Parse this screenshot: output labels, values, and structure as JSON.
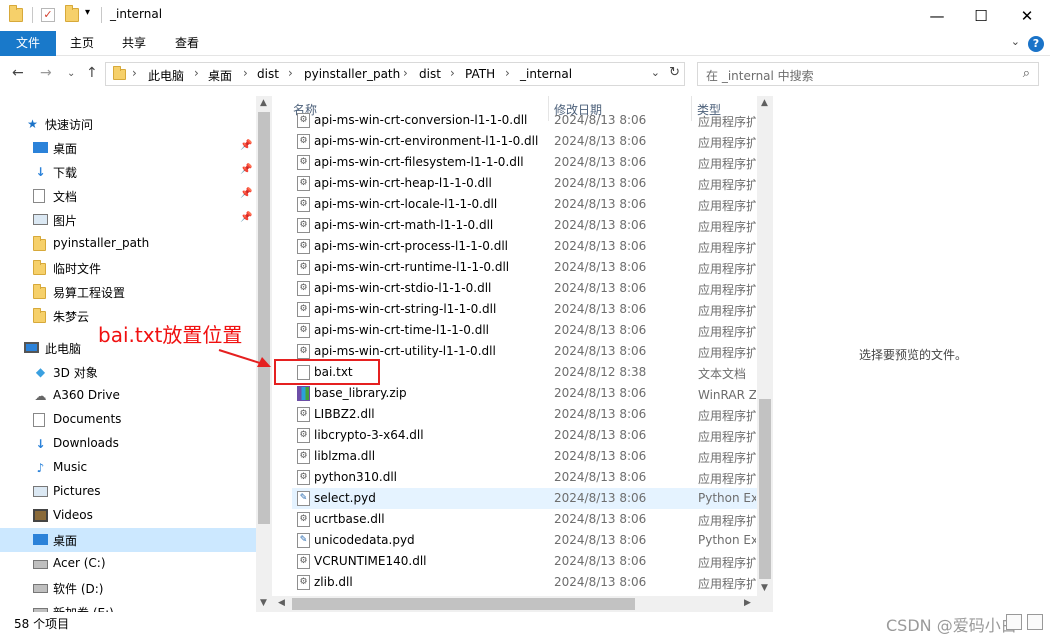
{
  "window": {
    "title": "_internal",
    "minimize": "—",
    "maximize": "☐",
    "close": "✕"
  },
  "ribbon": {
    "tabs": [
      "文件",
      "主页",
      "共享",
      "查看"
    ],
    "help": "?"
  },
  "address": {
    "crumbs": [
      "此电脑",
      "桌面",
      "dist",
      "pyinstaller_path",
      "dist",
      "PATH",
      "_internal"
    ],
    "separator": "›"
  },
  "search": {
    "placeholder": "在 _internal 中搜索"
  },
  "nav": {
    "quick_access": "快速访问",
    "items": [
      {
        "label": "桌面",
        "icon": "desktop-icon",
        "pinned": true
      },
      {
        "label": "下载",
        "icon": "download-icon",
        "pinned": true
      },
      {
        "label": "文档",
        "icon": "document-icon",
        "pinned": true
      },
      {
        "label": "图片",
        "icon": "picture-icon",
        "pinned": true
      },
      {
        "label": "pyinstaller_path",
        "icon": "folder-icon",
        "pinned": false
      },
      {
        "label": "临时文件",
        "icon": "folder-icon",
        "pinned": false
      },
      {
        "label": "易算工程设置",
        "icon": "folder-icon",
        "pinned": false
      },
      {
        "label": "朱梦云",
        "icon": "folder-icon",
        "pinned": false
      }
    ],
    "this_pc": "此电脑",
    "pc_items": [
      {
        "label": "3D 对象",
        "icon": "3d-objects-icon"
      },
      {
        "label": "A360 Drive",
        "icon": "cloud-drive-icon"
      },
      {
        "label": "Documents",
        "icon": "document-icon"
      },
      {
        "label": "Downloads",
        "icon": "download-icon"
      },
      {
        "label": "Music",
        "icon": "music-icon"
      },
      {
        "label": "Pictures",
        "icon": "picture-icon"
      },
      {
        "label": "Videos",
        "icon": "video-icon"
      },
      {
        "label": "桌面",
        "icon": "desktop-icon",
        "selected": true
      },
      {
        "label": "Acer (C:)",
        "icon": "drive-icon"
      },
      {
        "label": "软件 (D:)",
        "icon": "drive-icon"
      },
      {
        "label": "新加卷 (E:)",
        "icon": "drive-icon"
      }
    ]
  },
  "columns": {
    "name": "名称",
    "date": "修改日期",
    "type": "类型"
  },
  "files": [
    {
      "name": "api-ms-win-crt-conversion-l1-1-0.dll",
      "date": "2024/8/13 8:06",
      "type": "应用程序扩展",
      "icon": "dll"
    },
    {
      "name": "api-ms-win-crt-environment-l1-1-0.dll",
      "date": "2024/8/13 8:06",
      "type": "应用程序扩展",
      "icon": "dll"
    },
    {
      "name": "api-ms-win-crt-filesystem-l1-1-0.dll",
      "date": "2024/8/13 8:06",
      "type": "应用程序扩展",
      "icon": "dll"
    },
    {
      "name": "api-ms-win-crt-heap-l1-1-0.dll",
      "date": "2024/8/13 8:06",
      "type": "应用程序扩展",
      "icon": "dll"
    },
    {
      "name": "api-ms-win-crt-locale-l1-1-0.dll",
      "date": "2024/8/13 8:06",
      "type": "应用程序扩展",
      "icon": "dll"
    },
    {
      "name": "api-ms-win-crt-math-l1-1-0.dll",
      "date": "2024/8/13 8:06",
      "type": "应用程序扩展",
      "icon": "dll"
    },
    {
      "name": "api-ms-win-crt-process-l1-1-0.dll",
      "date": "2024/8/13 8:06",
      "type": "应用程序扩展",
      "icon": "dll"
    },
    {
      "name": "api-ms-win-crt-runtime-l1-1-0.dll",
      "date": "2024/8/13 8:06",
      "type": "应用程序扩展",
      "icon": "dll"
    },
    {
      "name": "api-ms-win-crt-stdio-l1-1-0.dll",
      "date": "2024/8/13 8:06",
      "type": "应用程序扩展",
      "icon": "dll"
    },
    {
      "name": "api-ms-win-crt-string-l1-1-0.dll",
      "date": "2024/8/13 8:06",
      "type": "应用程序扩展",
      "icon": "dll"
    },
    {
      "name": "api-ms-win-crt-time-l1-1-0.dll",
      "date": "2024/8/13 8:06",
      "type": "应用程序扩展",
      "icon": "dll"
    },
    {
      "name": "api-ms-win-crt-utility-l1-1-0.dll",
      "date": "2024/8/13 8:06",
      "type": "应用程序扩展",
      "icon": "dll"
    },
    {
      "name": "bai.txt",
      "date": "2024/8/12 8:38",
      "type": "文本文档",
      "icon": "txt"
    },
    {
      "name": "base_library.zip",
      "date": "2024/8/13 8:06",
      "type": "WinRAR ZIP 压缩文件",
      "icon": "zip"
    },
    {
      "name": "LIBBZ2.dll",
      "date": "2024/8/13 8:06",
      "type": "应用程序扩展",
      "icon": "dll"
    },
    {
      "name": "libcrypto-3-x64.dll",
      "date": "2024/8/13 8:06",
      "type": "应用程序扩展",
      "icon": "dll"
    },
    {
      "name": "liblzma.dll",
      "date": "2024/8/13 8:06",
      "type": "应用程序扩展",
      "icon": "dll"
    },
    {
      "name": "python310.dll",
      "date": "2024/8/13 8:06",
      "type": "应用程序扩展",
      "icon": "dll"
    },
    {
      "name": "select.pyd",
      "date": "2024/8/13 8:06",
      "type": "Python Extension Module",
      "icon": "py",
      "hover": true
    },
    {
      "name": "ucrtbase.dll",
      "date": "2024/8/13 8:06",
      "type": "应用程序扩展",
      "icon": "dll"
    },
    {
      "name": "unicodedata.pyd",
      "date": "2024/8/13 8:06",
      "type": "Python Extension Module",
      "icon": "py"
    },
    {
      "name": "VCRUNTIME140.dll",
      "date": "2024/8/13 8:06",
      "type": "应用程序扩展",
      "icon": "dll"
    },
    {
      "name": "zlib.dll",
      "date": "2024/8/13 8:06",
      "type": "应用程序扩展",
      "icon": "dll"
    }
  ],
  "preview": {
    "empty_text": "选择要预览的文件。"
  },
  "annotation": {
    "text": "bai.txt放置位置"
  },
  "status": {
    "count": "58 个项目"
  },
  "watermark": "CSDN @爱码小白",
  "colors": {
    "ribbon_file_tab": "#1979ca",
    "selection": "#cce8ff",
    "annotation": "#e52020"
  }
}
